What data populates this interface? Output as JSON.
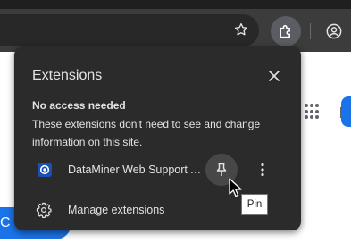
{
  "browser": {
    "toolbar": {
      "bookmark_icon": "star-icon",
      "extensions_icon": "puzzle-icon",
      "profile_icon": "account-icon"
    },
    "page": {
      "apps_icon": "apps-grid-icon",
      "partial_button_text": "C"
    }
  },
  "extensions_popup": {
    "title": "Extensions",
    "close_icon": "close-icon",
    "section": {
      "heading": "No access needed",
      "description": "These extensions don't need to see and change information on this site."
    },
    "extensions": [
      {
        "name": "DataMiner Web Support A…",
        "icon": "dataminer-icon",
        "pin_icon": "pin-icon",
        "more_icon": "more-vert-icon"
      }
    ],
    "manage_label": "Manage extensions",
    "manage_icon": "gear-icon"
  },
  "tooltip": {
    "text": "Pin"
  },
  "colors": {
    "popup_bg": "#2b2b2b",
    "text": "#e3e3e3",
    "accent_blue": "#1a73e8",
    "toolbar_bg": "#3c3c3c"
  }
}
